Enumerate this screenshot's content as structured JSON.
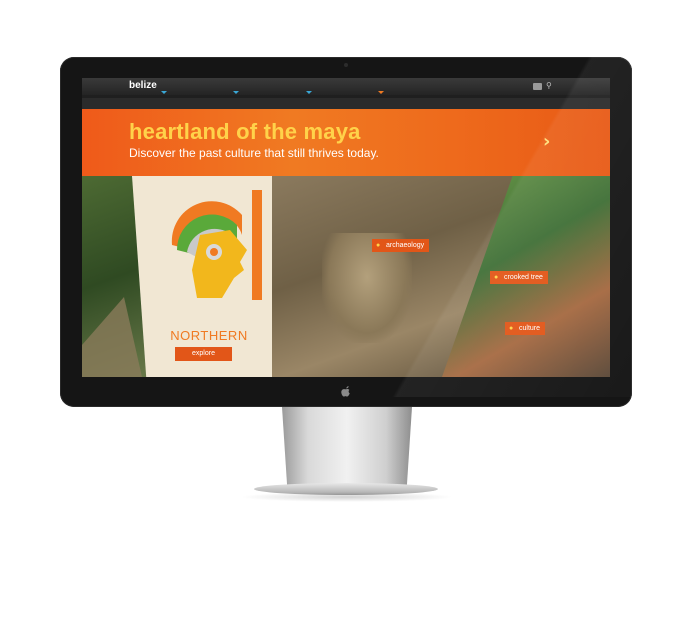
{
  "site": {
    "logo": "belize"
  },
  "nav": {
    "markers": [
      "#3aa7d6",
      "#3aa7d6",
      "#3aa7d6",
      "#3aa7d6"
    ],
    "camera_icon": "camera-icon",
    "search_icon": "search-icon"
  },
  "banner": {
    "title": "heartland of the maya",
    "subtitle": "Discover the past culture that still thrives today.",
    "next_icon": "chevron-right-icon"
  },
  "regions": {
    "feature_title": "NORTHERN",
    "explore_label": "explore"
  },
  "tags": [
    {
      "label": "archaeology",
      "icon": "map-pin-icon"
    },
    {
      "label": "crooked tree",
      "icon": "map-pin-icon"
    },
    {
      "label": "culture",
      "icon": "map-pin-icon"
    }
  ],
  "colors": {
    "accent_orange": "#e25618",
    "banner_title_yellow": "#ffd24a",
    "navbar": "#2b2b2b"
  }
}
